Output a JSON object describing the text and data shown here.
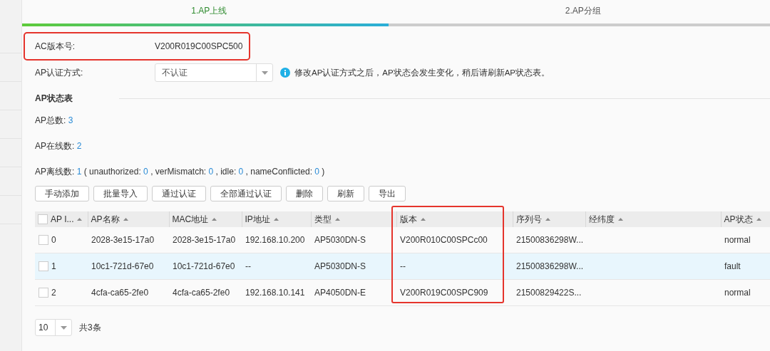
{
  "steps": [
    {
      "label": "1.AP上线",
      "selected": true
    },
    {
      "label": "2.AP分组",
      "selected": false
    }
  ],
  "progress": {
    "level": 0.49
  },
  "ac_version": {
    "label": "AC版本号:",
    "value": "V200R019C00SPC500",
    "highlighted": true
  },
  "auth": {
    "label": "AP认证方式:",
    "value": "不认证",
    "info": "修改AP认证方式之后，AP状态会发生变化，稍后请刷新AP状态表。"
  },
  "section_title": "AP状态表",
  "total": {
    "label": "AP总数:",
    "value": "3"
  },
  "online": {
    "label": "AP在线数:",
    "value": "2"
  },
  "offline": {
    "label": "AP离线数:",
    "value": "1",
    "open": "(",
    "close": ")",
    "separator": ",",
    "details": [
      {
        "label": "unauthorized:",
        "value": "0"
      },
      {
        "label": "verMismatch:",
        "value": "0"
      },
      {
        "label": "idle:",
        "value": "0"
      },
      {
        "label": "nameConflicted:",
        "value": "0"
      }
    ]
  },
  "buttons": [
    "手动添加",
    "批量导入",
    "通过认证",
    "全部通过认证",
    "删除",
    "刷新",
    "导出"
  ],
  "table": {
    "select_all": {
      "checked": false
    },
    "columns": [
      {
        "label": "AP I...",
        "highlighted": false
      },
      {
        "label": "AP名称",
        "highlighted": false
      },
      {
        "label": "MAC地址",
        "highlighted": false
      },
      {
        "label": "IP地址",
        "highlighted": false
      },
      {
        "label": "类型",
        "highlighted": false
      },
      {
        "label": "版本",
        "highlighted": true
      },
      {
        "label": "序列号",
        "highlighted": false
      },
      {
        "label": "经纬度",
        "highlighted": false
      },
      {
        "label": "AP状态",
        "highlighted": false
      }
    ],
    "rows": [
      {
        "checked": false,
        "hovered": false,
        "cells": [
          "0",
          "2028-3e15-17a0",
          "2028-3e15-17a0",
          "192.168.10.200",
          "AP5030DN-S",
          "V200R010C00SPCc00",
          "21500836298W...",
          "",
          "normal"
        ]
      },
      {
        "checked": false,
        "hovered": true,
        "cells": [
          "1",
          "10c1-721d-67e0",
          "10c1-721d-67e0",
          "--",
          "AP5030DN-S",
          "--",
          "21500836298W...",
          "",
          "fault"
        ]
      },
      {
        "checked": false,
        "hovered": false,
        "cells": [
          "2",
          "4cfa-ca65-2fe0",
          "4cfa-ca65-2fe0",
          "192.168.10.141",
          "AP4050DN-E",
          "V200R019C00SPC909",
          "21500829422S...",
          "",
          "normal"
        ]
      }
    ]
  },
  "pagination": {
    "page_size": "10",
    "total": "共3条"
  }
}
